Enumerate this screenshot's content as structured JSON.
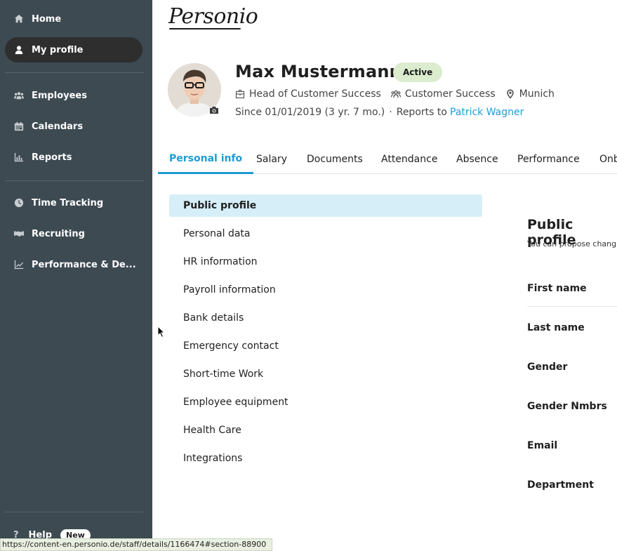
{
  "sidebar": {
    "items": [
      {
        "label": "Home",
        "icon": "home-icon"
      },
      {
        "label": "My profile",
        "icon": "user-icon",
        "active": true
      },
      {
        "label": "Employees",
        "icon": "users-icon"
      },
      {
        "label": "Calendars",
        "icon": "calendar-icon"
      },
      {
        "label": "Reports",
        "icon": "bar-chart-icon"
      },
      {
        "label": "Time Tracking",
        "icon": "clock-icon"
      },
      {
        "label": "Recruiting",
        "icon": "handshake-icon"
      },
      {
        "label": "Performance & De...",
        "icon": "line-chart-icon"
      }
    ],
    "help_label": "Help",
    "new_badge": "New"
  },
  "brand": {
    "logo_text": "Personio"
  },
  "profile": {
    "name": "Max Mustermann",
    "status": "Active",
    "position": "Head of Customer Success",
    "department": "Customer Success",
    "location": "Munich",
    "since": "Since 01/01/2019 (3 yr. 7 mo.)",
    "separator": "·",
    "reports_to_label": "Reports to",
    "reports_to_name": "Patrick Wagner"
  },
  "tabs": [
    "Personal info",
    "Salary",
    "Documents",
    "Attendance",
    "Absence",
    "Performance",
    "Onb"
  ],
  "sections": [
    "Public profile",
    "Personal data",
    "HR information",
    "Payroll information",
    "Bank details",
    "Emergency contact",
    "Short-time Work",
    "Employee equipment",
    "Health Care",
    "Integrations"
  ],
  "panel": {
    "title": "Public profile",
    "subtitle": "You can propose chang",
    "fields": [
      "First name",
      "Last name",
      "Gender",
      "Gender Nmbrs",
      "Email",
      "Department"
    ]
  },
  "statusbar": {
    "url": "https://content-en.personio.de/staff/details/1166474#section-88900"
  },
  "colors": {
    "sidebar_bg": "#3d4a52",
    "accent": "#1d9cd3",
    "active_section_bg": "#d6eef8",
    "status_badge_bg": "#dceccf"
  }
}
